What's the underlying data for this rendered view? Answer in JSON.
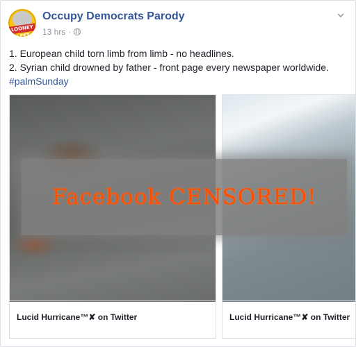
{
  "post": {
    "page_name": "Occupy Democrats Parody",
    "timestamp": "13 hrs",
    "meta_separator": "·",
    "avatar_text": "LOONEY LEFT",
    "line1": "1. European child torn limb from limb - no headlines.",
    "line2": "2. Syrian child drowned by father - front page every newspaper worldwide.",
    "hashtag": "#palmSunday"
  },
  "carousel": {
    "items": [
      {
        "caption": "Lucid Hurricane™✘ on Twitter"
      },
      {
        "caption": "Lucid Hurricane™✘ on Twitter"
      }
    ]
  },
  "overlay": {
    "text": "Facebook CENSORED!",
    "color": "#ff4d00"
  },
  "icons": {
    "privacy": "globe-icon",
    "options": "chevron-down-icon"
  }
}
